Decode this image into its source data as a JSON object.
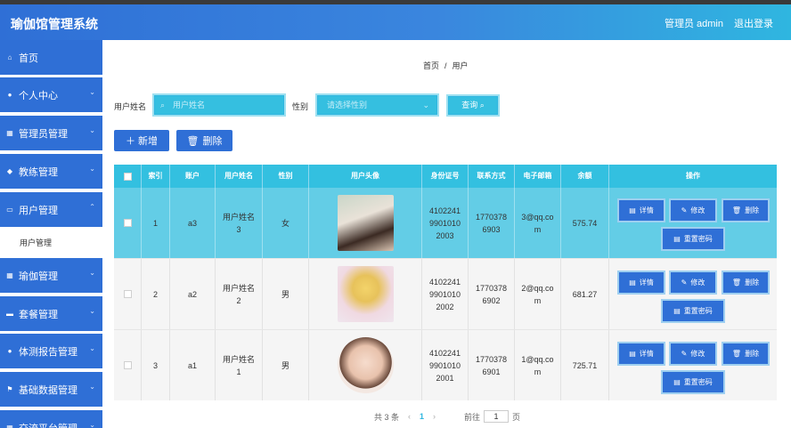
{
  "header": {
    "title": "瑜伽馆管理系统",
    "admin": "管理员 admin",
    "logout": "退出登录"
  },
  "sidebar": {
    "items": [
      {
        "label": "首页",
        "icon": "home-icon",
        "glyph": "⌂"
      },
      {
        "label": "个人中心",
        "icon": "user-icon",
        "glyph": "●"
      },
      {
        "label": "管理员管理",
        "icon": "grid-icon",
        "glyph": "▦"
      },
      {
        "label": "教练管理",
        "icon": "cap-icon",
        "glyph": "◆"
      },
      {
        "label": "用户管理",
        "icon": "monitor-icon",
        "glyph": "▭"
      },
      {
        "label": "瑜伽管理",
        "icon": "grid-icon",
        "glyph": "▦"
      },
      {
        "label": "套餐管理",
        "icon": "message-icon",
        "glyph": "▬"
      },
      {
        "label": "体测报告管理",
        "icon": "user-icon",
        "glyph": "●"
      },
      {
        "label": "基础数据管理",
        "icon": "flag-icon",
        "glyph": "⚑"
      },
      {
        "label": "交流平台管理",
        "icon": "grid-icon",
        "glyph": "▦"
      }
    ],
    "submenu": {
      "label": "用户管理"
    }
  },
  "breadcrumb": {
    "home": "首页",
    "sep": "/",
    "current": "用户"
  },
  "search": {
    "name_label": "用户姓名",
    "name_placeholder": "用户姓名",
    "gender_label": "性别",
    "gender_placeholder": "请选择性别",
    "query_label": "查询"
  },
  "toolbar": {
    "add_label": "＋ 新增",
    "delete_label": "删除"
  },
  "table": {
    "headers": [
      "索引",
      "账户",
      "用户姓名",
      "性别",
      "用户头像",
      "身份证号",
      "联系方式",
      "电子邮箱",
      "余额",
      "操作"
    ],
    "rows": [
      {
        "index": "1",
        "account": "a3",
        "name": "用户姓名\n3",
        "gender": "女",
        "avatar": "avatar-girl-profile",
        "idcard": "4102241\n9901010\n2003",
        "phone": "1770378\n6903",
        "email": "3@qq.co\nm",
        "balance": "575.74"
      },
      {
        "index": "2",
        "account": "a2",
        "name": "用户姓名\n2",
        "gender": "男",
        "avatar": "avatar-cartoon-girl",
        "idcard": "4102241\n9901010\n2002",
        "phone": "1770378\n6902",
        "email": "2@qq.co\nm",
        "balance": "681.27"
      },
      {
        "index": "3",
        "account": "a1",
        "name": "用户姓名\n1",
        "gender": "男",
        "avatar": "avatar-illustrated-girl",
        "idcard": "4102241\n9901010\n2001",
        "phone": "1770378\n6901",
        "email": "1@qq.co\nm",
        "balance": "725.71"
      }
    ],
    "ops": {
      "detail": "详情",
      "edit": "修改",
      "delete": "删除",
      "reset": "重置密码"
    }
  },
  "pagination": {
    "total": "共 3 条",
    "prev": "‹",
    "current": "1",
    "next": "›",
    "goto": "前往",
    "page_value": "1",
    "page_unit": "页"
  },
  "colors": {
    "primary": "#2f6fd6",
    "accent": "#35bfe0",
    "selected_row": "#63cde6"
  }
}
